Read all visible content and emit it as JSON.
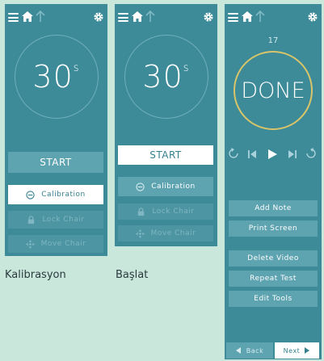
{
  "colors": {
    "background": "#c9e7da",
    "panel": "#3d8a99",
    "button": "#5ea3b0",
    "button_highlight": "#ffffff",
    "done_ring": "#d9c569"
  },
  "panel1": {
    "timer_value": "30",
    "timer_unit": "s",
    "start_label": "START",
    "calibration_label": "Calibration",
    "lock_label": "Lock Chair",
    "move_label": "Move Chair",
    "selected": "calibration"
  },
  "panel2": {
    "timer_value": "30",
    "timer_unit": "s",
    "start_label": "START",
    "calibration_label": "Calibration",
    "lock_label": "Lock Chair",
    "move_label": "Move Chair",
    "selected": "start"
  },
  "panel3": {
    "counter": "17",
    "status": "DONE",
    "add_note_label": "Add Note",
    "print_label": "Print Screen",
    "delete_label": "Delete Video",
    "repeat_label": "Repeat Test",
    "edit_label": "Edit Tools",
    "back_label": "Back",
    "next_label": "Next"
  },
  "captions": {
    "panel1": "Kalibrasyon",
    "panel2": "Başlat"
  },
  "icons": [
    "menu-icon",
    "home-icon",
    "up-arrow-icon",
    "gear-icon",
    "target-icon",
    "lock-icon",
    "move-icon",
    "rotate-left-icon",
    "step-back-icon",
    "play-icon",
    "step-forward-icon",
    "rotate-right-icon",
    "back-arrow-icon",
    "next-arrow-icon"
  ]
}
